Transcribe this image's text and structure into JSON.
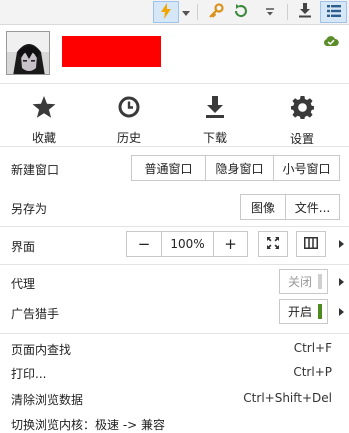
{
  "toolbar": {
    "icons": [
      "lightning-icon",
      "dropdown-arrow-icon",
      "key-icon",
      "refresh-icon",
      "small-dropdown-icon",
      "download-icon",
      "menu-list-icon"
    ]
  },
  "profile": {
    "status_icon": "cloud-check-icon",
    "status_color": "#5b8c2a"
  },
  "quick_actions": [
    {
      "label": "收藏",
      "icon": "star-icon"
    },
    {
      "label": "历史",
      "icon": "clock-icon"
    },
    {
      "label": "下载",
      "icon": "download-icon"
    },
    {
      "label": "设置",
      "icon": "gear-icon"
    }
  ],
  "new_window": {
    "label": "新建窗口",
    "buttons": [
      "普通窗口",
      "隐身窗口",
      "小号窗口"
    ]
  },
  "save_as": {
    "label": "另存为",
    "buttons": [
      "图像",
      "文件..."
    ]
  },
  "ui": {
    "label": "界面",
    "zoom_minus": "−",
    "zoom_value": "100%",
    "zoom_plus": "+"
  },
  "proxy": {
    "label": "代理",
    "toggle_text": "关闭",
    "state": "off"
  },
  "adblock": {
    "label": "广告猎手",
    "toggle_text": "开启",
    "state": "on",
    "on_color": "#4e8b1f"
  },
  "menu_items": [
    {
      "label": "页面内查找",
      "shortcut": "Ctrl+F"
    },
    {
      "label": "打印...",
      "shortcut": "Ctrl+P"
    },
    {
      "label": "清除浏览数据",
      "shortcut": "Ctrl+Shift+Del"
    },
    {
      "label": "切换浏览内核：极速 -> 兼容",
      "shortcut": ""
    }
  ]
}
